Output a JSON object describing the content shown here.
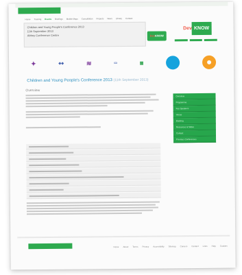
{
  "top_button": "",
  "nav": [
    "Home",
    "Training",
    "Events",
    "Briefings",
    "Mobile Maps",
    "Consultation",
    "Projects",
    "News",
    "Library",
    "Contact"
  ],
  "nav_active_index": 2,
  "headline": [
    "Children and Young People's Conference 2013",
    "11th September 2013",
    "Abbey Conference Centre",
    ""
  ],
  "brand_logo": {
    "part1": "Dev",
    "part2": "KNOW"
  },
  "partners": [
    "",
    "",
    "",
    "",
    "",
    ""
  ],
  "page_title": "Children and Young People's Conference 2013",
  "page_subtitle": "(11th September 2013)",
  "overview_heading": "Overview",
  "sidebar_items": [
    "Overview",
    "Programme",
    "Key Speakers",
    "Venue",
    "Booking",
    "Resources & Slides",
    "Contact",
    "Previous Conferences"
  ],
  "footer_button": "",
  "footer_links": [
    "Home",
    "About",
    "Terms",
    "Privacy",
    "Accessibility",
    "Sitemap",
    "Careers",
    "Contact",
    "Links",
    "Help",
    "Cookies"
  ],
  "colors": {
    "accent_green": "#2eaa4f",
    "title_blue": "#2c8fbf",
    "brand_red": "#f05a4a"
  }
}
